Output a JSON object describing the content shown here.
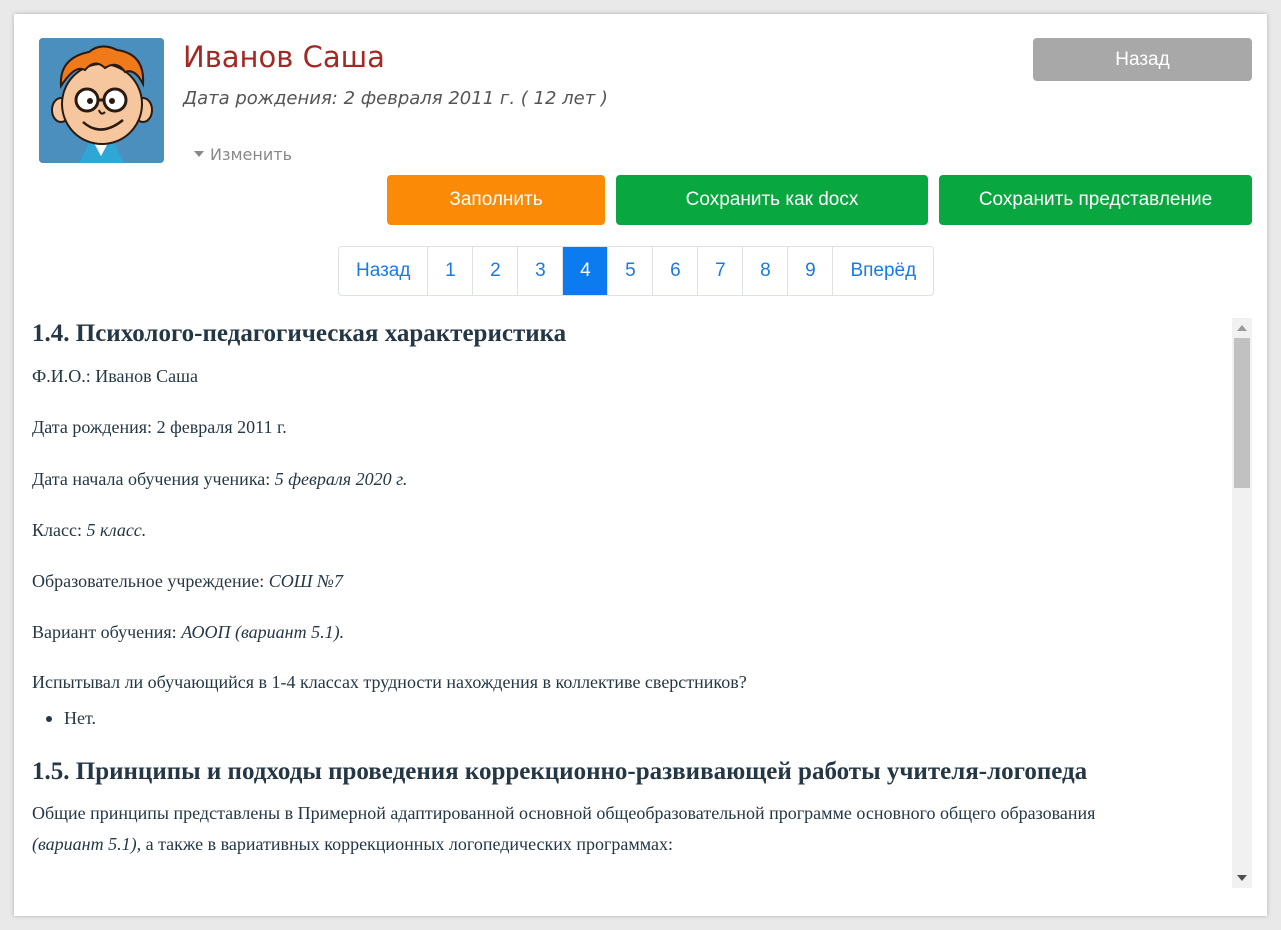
{
  "profile": {
    "name": "Иванов Саша",
    "birth_line": "Дата рождения: 2 февраля 2011 г. ( 12 лет )",
    "edit_label": "Изменить",
    "back_label": "Назад"
  },
  "actions": {
    "fill_label": "Заполнить",
    "save_docx_label": "Сохранить как docx",
    "save_view_label": "Сохранить представление"
  },
  "pagination": {
    "prev": "Назад",
    "pages": [
      "1",
      "2",
      "3",
      "4",
      "5",
      "6",
      "7",
      "8",
      "9"
    ],
    "current": "4",
    "next": "Вперёд"
  },
  "document": {
    "section1_title": "1.4. Психолого-педагогическая характеристика",
    "fio_label": "Ф.И.О.: ",
    "fio_value": "Иванов Саша",
    "birth_label": "Дата рождения: ",
    "birth_value": "2 февраля 2011 г.",
    "start_label": "Дата начала обучения ученика: ",
    "start_value": "5 февраля 2020 г.",
    "class_label": "Класс: ",
    "class_value": "5 класс.",
    "school_label": "Образовательное учреждение: ",
    "school_value": "СОШ №7",
    "variant_label": "Вариант обучения: ",
    "variant_value": "АООП (вариант 5.1).",
    "question": "Испытывал ли обучающийся в 1-4 классах трудности нахождения в коллективе сверстников?",
    "answer": "Нет.",
    "section2_title": "1.5. Принципы и подходы проведения коррекционно-развивающей работы учителя-логопеда",
    "para_line1": "Общие принципы представлены в Примерной адаптированной основной общеобразовательной программе основного общего образования",
    "para_line2_italic": "(вариант 5.1),",
    "para_line2_rest": " а также в вариативных коррекционных логопедических программах:"
  },
  "colors": {
    "name": "#a12a24",
    "orange": "#fb8a06",
    "green": "#09a73f",
    "gray_button": "#a8a8a8",
    "link": "#1a7ae2",
    "active_page": "#0d7bf0"
  }
}
